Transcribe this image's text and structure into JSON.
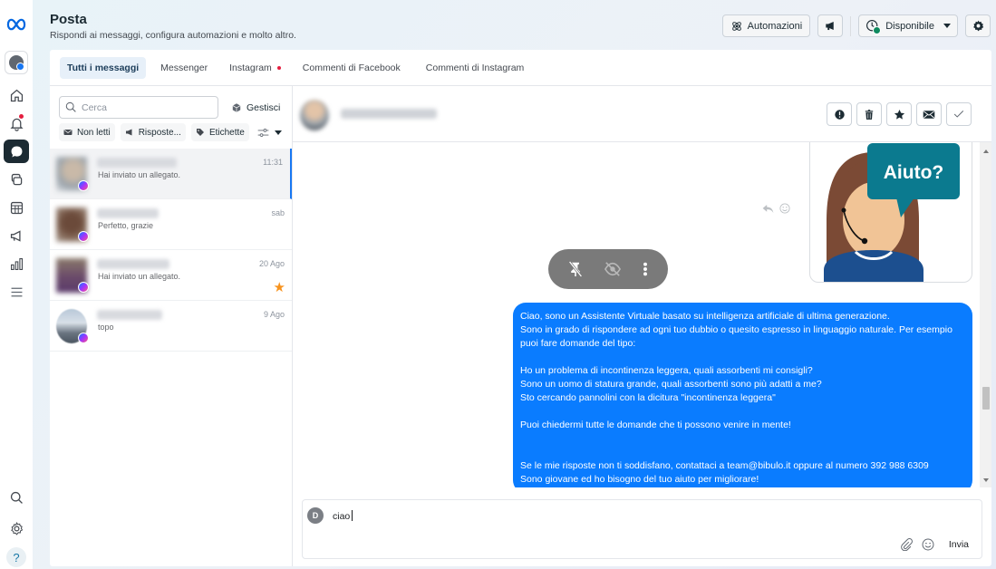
{
  "app": {
    "title": "Posta",
    "subtitle": "Rispondi ai messaggi, configura automazioni e molto altro."
  },
  "top_actions": {
    "automations_label": "Automazioni",
    "status_label": "Disponibile",
    "status_color": "#0f8a5f"
  },
  "tabs": [
    {
      "label": "Tutti i messaggi",
      "active": true
    },
    {
      "label": "Messenger"
    },
    {
      "label": "Instagram",
      "has_dot": true
    },
    {
      "label": "Commenti di Facebook"
    },
    {
      "label": "Commenti di Instagram"
    }
  ],
  "list": {
    "search_placeholder": "Cerca",
    "manage_label": "Gestisci",
    "filters": [
      "Non letti",
      "Risposte...",
      "Etichette"
    ],
    "conversations": [
      {
        "preview": "Hai inviato un allegato.",
        "time": "11:31",
        "selected": true
      },
      {
        "preview": "Perfetto, grazie",
        "time": "sab"
      },
      {
        "preview": "Hai inviato un allegato.",
        "time": "20 Ago",
        "starred": true
      },
      {
        "preview": "topo",
        "time": "9 Ago"
      }
    ]
  },
  "thread": {
    "image_text": "Aiuto?",
    "message_lines": "Ciao, sono un Assistente Virtuale basato su intelligenza artificiale di ultima generazione.\nSono in grado di rispondere ad ogni tuo dubbio o quesito espresso in linguaggio naturale. Per esempio puoi fare domande del tipo:\n\nHo un problema di incontinenza leggera, quali assorbenti mi consigli?\nSono un uomo di statura grande, quali assorbenti sono più adatti a me?\nSto cercando pannolini con la dicitura \"incontinenza leggera\"\n\nPuoi chiedermi tutte le domande che ti possono venire in mente!\n\n\nSe le mie risposte non ti soddisfano, contattaci a team@bibulo.it oppure al numero 392 988 6309\nSono giovane ed ho bisogno del tuo aiuto per migliorare!"
  },
  "composer": {
    "avatar_initial": "D",
    "value": "ciao",
    "send_label": "Invia"
  }
}
